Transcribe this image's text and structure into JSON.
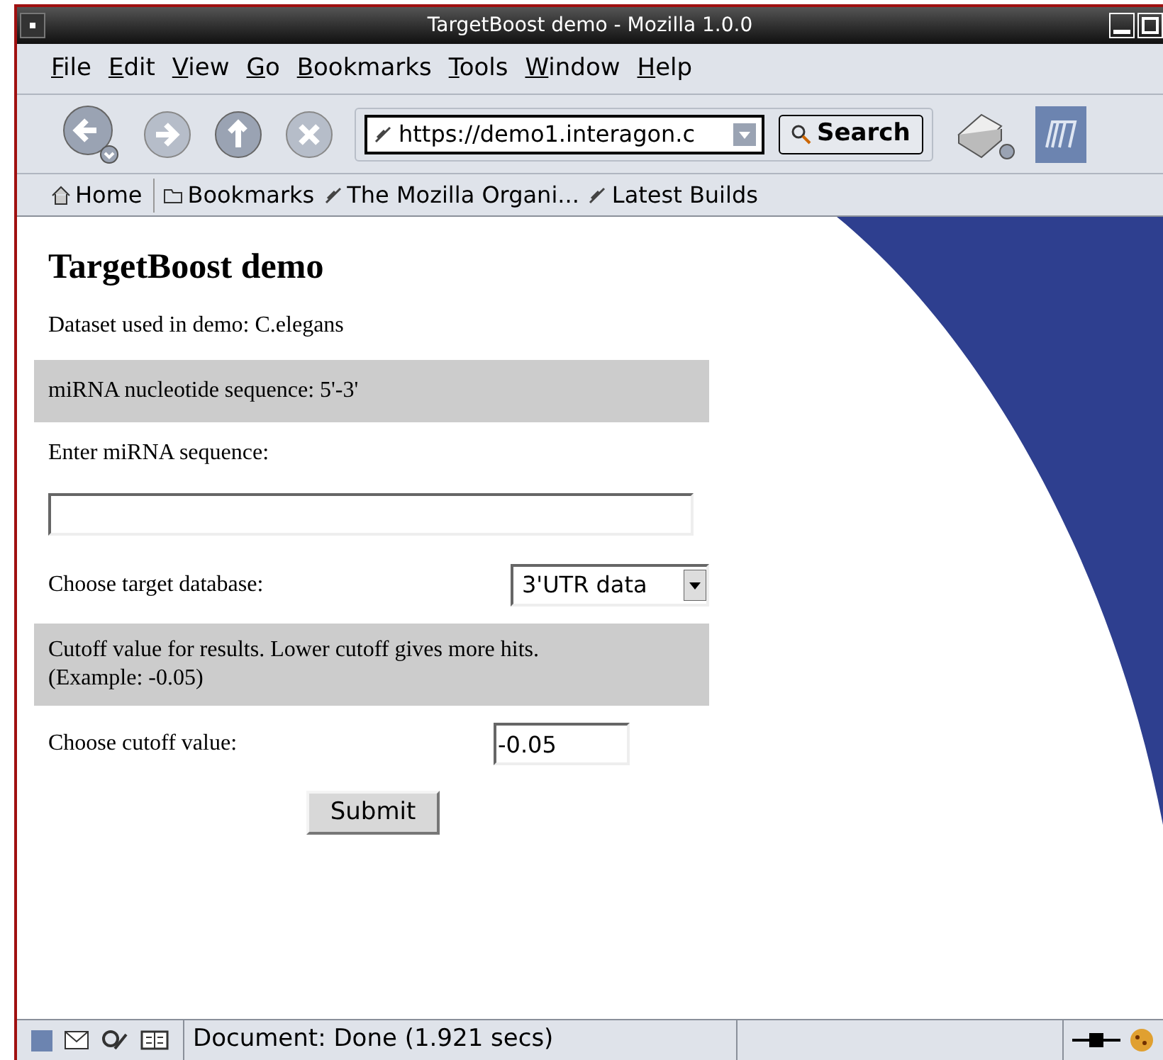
{
  "window": {
    "title": "TargetBoost demo - Mozilla 1.0.0"
  },
  "menu": [
    "File",
    "Edit",
    "View",
    "Go",
    "Bookmarks",
    "Tools",
    "Window",
    "Help"
  ],
  "toolbar": {
    "url": "https://demo1.interagon.c",
    "search": "Search"
  },
  "bookmarks": [
    {
      "kind": "home",
      "label": "Home"
    },
    {
      "kind": "folder",
      "label": "Bookmarks"
    },
    {
      "kind": "link",
      "label": "The Mozilla Organi..."
    },
    {
      "kind": "link",
      "label": "Latest Builds"
    }
  ],
  "page": {
    "heading": "TargetBoost demo",
    "dataset": "Dataset used in demo: C.elegans",
    "section_1": "miRNA nucleotide sequence: 5'-3'",
    "sequence_label": "Enter miRNA sequence:",
    "database_label": "Choose target database:",
    "database_select": "3'UTR data",
    "section_2": "Cutoff value for results. Lower cutoff gives more hits. (Example: -0.05)",
    "cutoff_label": "Choose cutoff value:",
    "cutoff_value": "-0.05",
    "submit": "Submit"
  },
  "status_bar": {
    "text": "Document: Done (1.921 secs)"
  }
}
